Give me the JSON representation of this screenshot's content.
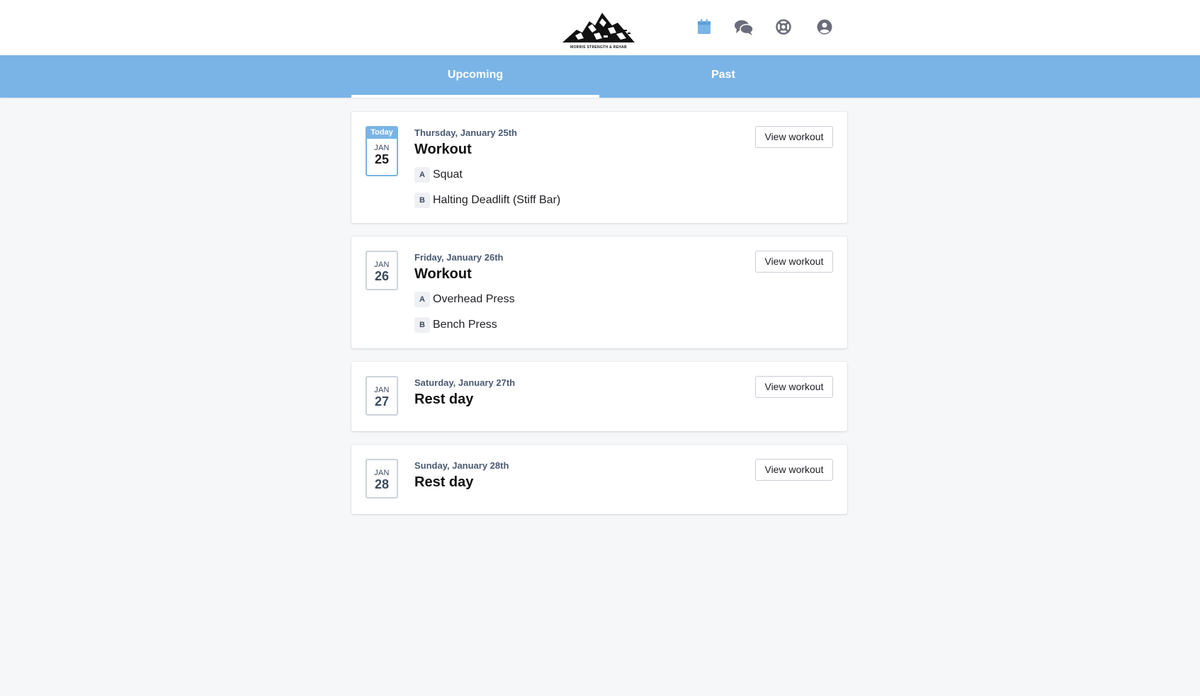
{
  "header": {
    "logo_text": "MORRIS STRENGTH & REHAB",
    "icons": [
      "calendar-icon",
      "chat-icon",
      "help-icon",
      "account-icon"
    ],
    "accent_color": "#7ab4e6",
    "icon_color": "#6b6c7a"
  },
  "tabs": [
    {
      "label": "Upcoming",
      "active": true
    },
    {
      "label": "Past",
      "active": false
    }
  ],
  "days": [
    {
      "today_label": "Today",
      "month": "JAN",
      "day": "25",
      "date_text": "Thursday, January 25th",
      "title": "Workout",
      "exercises": [
        {
          "letter": "A",
          "name": "Squat"
        },
        {
          "letter": "B",
          "name": "Halting Deadlift (Stiff Bar)"
        }
      ],
      "button_label": "View workout"
    },
    {
      "month": "JAN",
      "day": "26",
      "date_text": "Friday, January 26th",
      "title": "Workout",
      "exercises": [
        {
          "letter": "A",
          "name": "Overhead Press"
        },
        {
          "letter": "B",
          "name": "Bench Press"
        }
      ],
      "button_label": "View workout"
    },
    {
      "month": "JAN",
      "day": "27",
      "date_text": "Saturday, January 27th",
      "title": "Rest day",
      "exercises": [],
      "button_label": "View workout"
    },
    {
      "month": "JAN",
      "day": "28",
      "date_text": "Sunday, January 28th",
      "title": "Rest day",
      "exercises": [],
      "button_label": "View workout"
    }
  ]
}
